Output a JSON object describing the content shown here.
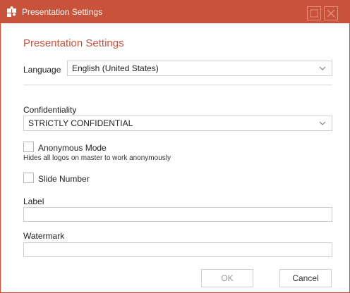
{
  "window": {
    "title": "Presentation Settings",
    "accent_color": "#c8533a",
    "icons": {
      "app": "puzzle-icon",
      "maximize": "maximize-icon",
      "close": "close-icon"
    }
  },
  "dialog": {
    "heading": "Presentation Settings",
    "language": {
      "label": "Language",
      "value": "English (United States)"
    },
    "confidentiality": {
      "label": "Confidentiality",
      "value": "STRICTLY CONFIDENTIAL"
    },
    "anonymous_mode": {
      "label": "Anonymous Mode",
      "hint": "Hides all logos on master to work anonymously",
      "checked": false
    },
    "slide_number": {
      "label": "Slide Number",
      "checked": false
    },
    "label_field": {
      "label": "Label",
      "value": ""
    },
    "watermark_field": {
      "label": "Watermark",
      "value": ""
    },
    "buttons": {
      "ok": "OK",
      "cancel": "Cancel"
    }
  }
}
